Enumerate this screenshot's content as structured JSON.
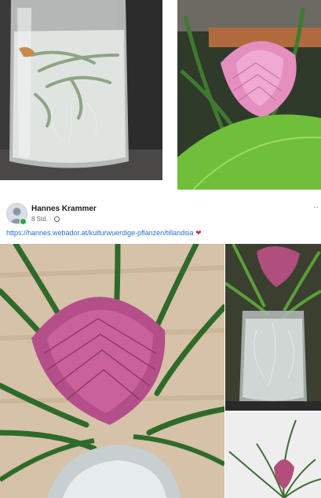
{
  "post": {
    "author": "Hannes Krammer",
    "time": "8 Std. ·",
    "link": "https://hannes.webador.at/kulturwuerdige-pflanzen/tillandsia",
    "emoji": "❤",
    "more": "··"
  },
  "icons": {
    "avatar": "avatar-icon",
    "globe": "globe-icon",
    "more": "more-options-icon"
  }
}
